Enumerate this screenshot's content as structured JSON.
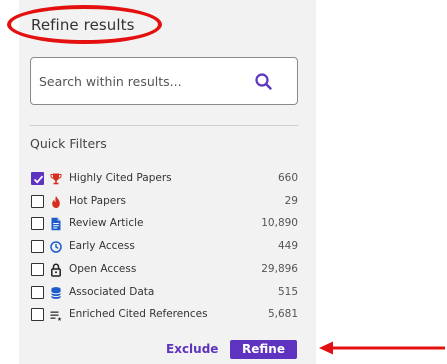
{
  "panel": {
    "title": "Refine results",
    "search": {
      "placeholder": "Search within results...",
      "value": ""
    },
    "quick_filters": {
      "heading": "Quick Filters",
      "items": [
        {
          "label": "Highly Cited Papers",
          "count": "660",
          "checked": true,
          "icon": "trophy-icon",
          "icon_color": "#d62d20"
        },
        {
          "label": "Hot Papers",
          "count": "29",
          "checked": false,
          "icon": "flame-icon",
          "icon_color": "#d62d20"
        },
        {
          "label": "Review Article",
          "count": "10,890",
          "checked": false,
          "icon": "document-icon",
          "icon_color": "#1e5dc8"
        },
        {
          "label": "Early Access",
          "count": "449",
          "checked": false,
          "icon": "clock-icon",
          "icon_color": "#1e5dc8"
        },
        {
          "label": "Open Access",
          "count": "29,896",
          "checked": false,
          "icon": "padlock-icon",
          "icon_color": "#222222"
        },
        {
          "label": "Associated Data",
          "count": "515",
          "checked": false,
          "icon": "database-icon",
          "icon_color": "#1e5dc8"
        },
        {
          "label": "Enriched Cited References",
          "count": "5,681",
          "checked": false,
          "icon": "enriched-list-icon",
          "icon_color": "#333333"
        }
      ]
    },
    "actions": {
      "exclude_label": "Exclude",
      "refine_label": "Refine"
    }
  },
  "colors": {
    "accent": "#5e33bf",
    "annotation": "#e41010",
    "panel_background": "#f2f2f2"
  }
}
